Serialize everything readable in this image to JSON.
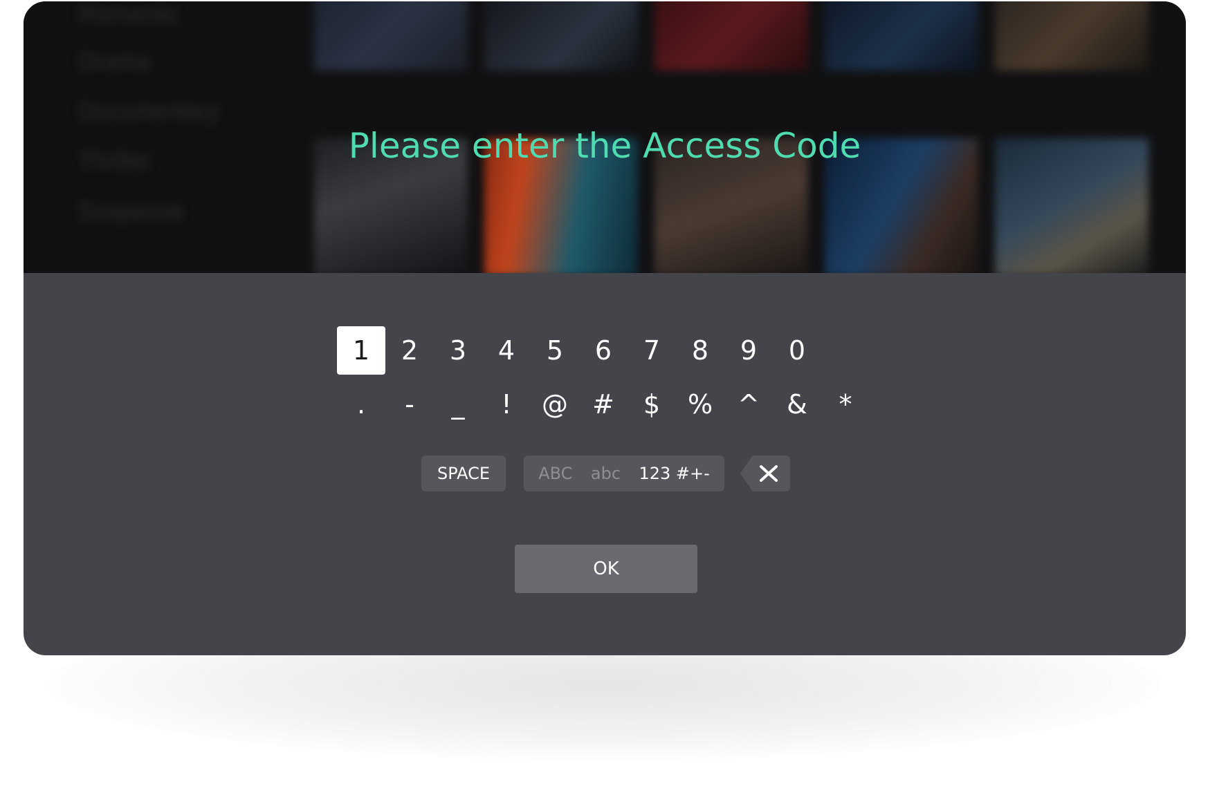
{
  "background": {
    "genres": [
      "Romantic",
      "Drama",
      "Documentary",
      "Thriller",
      "Suspense"
    ]
  },
  "dialog": {
    "title": "Please enter the Access Code"
  },
  "keyboard": {
    "row1": [
      "1",
      "2",
      "3",
      "4",
      "5",
      "6",
      "7",
      "8",
      "9",
      "0"
    ],
    "row2": [
      ".",
      "-",
      "_",
      "!",
      "@",
      "#",
      "$",
      "%",
      "^",
      "&",
      "*"
    ],
    "selected_key": "1",
    "space_label": "SPACE",
    "modes": [
      "ABC",
      "abc",
      "123 #+-"
    ],
    "active_mode": "123 #+-",
    "backspace_icon": "backspace-icon"
  },
  "actions": {
    "ok_label": "OK"
  },
  "colors": {
    "accent": "#4fdcb0",
    "panel": "#44454a",
    "key_bg": "#56575c",
    "ok_bg": "#6a6b70"
  }
}
